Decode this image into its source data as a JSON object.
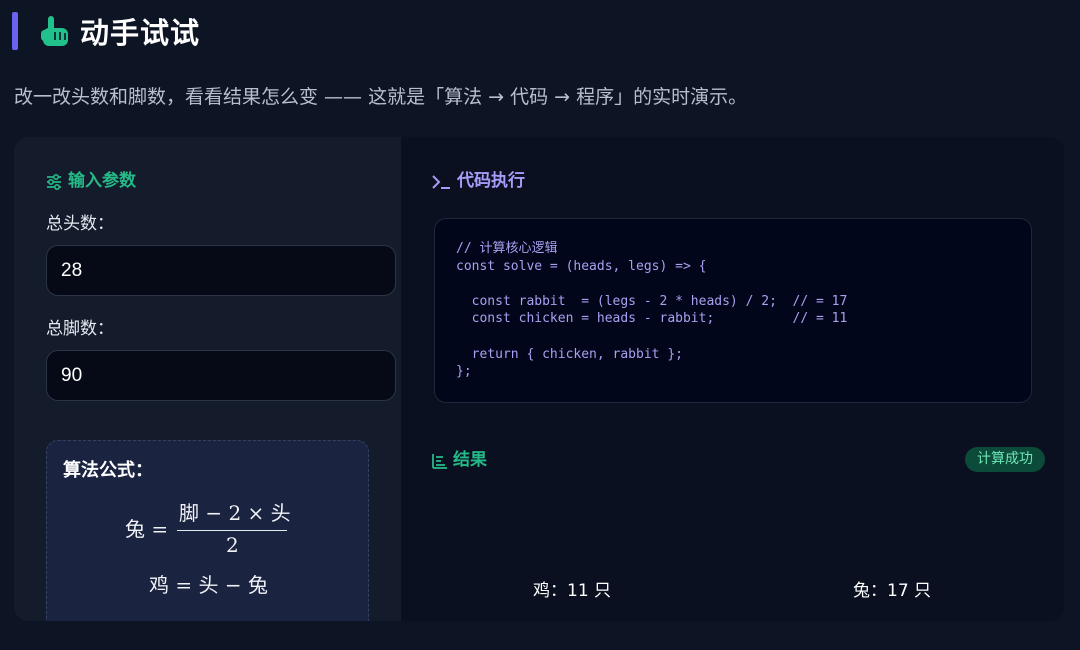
{
  "header": {
    "title": "动手试试",
    "subtitle": "改一改头数和脚数，看看结果怎么变 —— 这就是「算法 → 代码 → 程序」的实时演示。"
  },
  "input_panel": {
    "title": "输入参数",
    "heads_label": "总头数：",
    "heads_value": "28",
    "legs_label": "总脚数：",
    "legs_value": "90"
  },
  "formula": {
    "title": "算法公式：",
    "rabbit_lhs": "兔 =",
    "rabbit_numerator": "脚 − 2 × 头",
    "rabbit_denominator": "2",
    "chicken_eq": "鸡 = 头 − 兔"
  },
  "code_panel": {
    "title": "代码执行",
    "code": "// 计算核心逻辑\nconst solve = (heads, legs) => {\n\n  const rabbit  = (legs - 2 * heads) / 2;  // = 17\n  const chicken = heads - rabbit;          // = 11\n\n  return { chicken, rabbit };\n};"
  },
  "results": {
    "title": "结果",
    "status": "计算成功",
    "chicken": "鸡：11 只",
    "rabbit": "兔：17 只"
  },
  "colors": {
    "accent_bar": "#6b63f0",
    "green": "#25b987",
    "purple": "#a59cf7",
    "badge_bg": "#0c4a3a"
  },
  "icons": {
    "header": "pointing-hand-icon",
    "input": "sliders-icon",
    "code": "terminal-icon",
    "results": "bar-chart-icon"
  }
}
